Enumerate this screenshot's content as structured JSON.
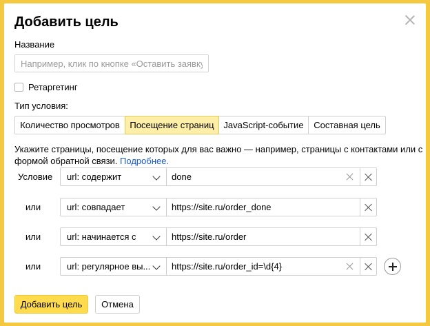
{
  "dialog": {
    "title": "Добавить цель",
    "name_label": "Название",
    "name_placeholder": "Например, клик по кнопке «Оставить заявку»",
    "name_value": "",
    "retargeting_label": "Ретаргетинг",
    "retargeting_checked": false,
    "condition_type_label": "Тип условия:",
    "tabs": [
      {
        "label": "Количество просмотров",
        "active": false
      },
      {
        "label": "Посещение страниц",
        "active": true
      },
      {
        "label": "JavaScript-событие",
        "active": false
      },
      {
        "label": "Составная цель",
        "active": false
      }
    ],
    "description": "Укажите страницы, посещение которых для вас важно — например, страницы с контактами или с формой обратной связи.",
    "more_link": "Подробнее.",
    "conditions": [
      {
        "label": "Условие",
        "operator": "url: содержит",
        "value": "done"
      },
      {
        "label": "или",
        "operator": "url: совпадает",
        "value": "https://site.ru/order_done"
      },
      {
        "label": "или",
        "operator": "url: начинается с",
        "value": "https://site.ru/order"
      },
      {
        "label": "или",
        "operator": "url: регулярное вы...",
        "value": "https://site.ru/order_id=\\d{4}"
      }
    ],
    "submit_label": "Добавить цель",
    "cancel_label": "Отмена"
  },
  "colors": {
    "background": "#f5c842",
    "active_tab": "#fdeea8",
    "primary_button": "#ffdb4d",
    "link": "#1a5bd6"
  }
}
